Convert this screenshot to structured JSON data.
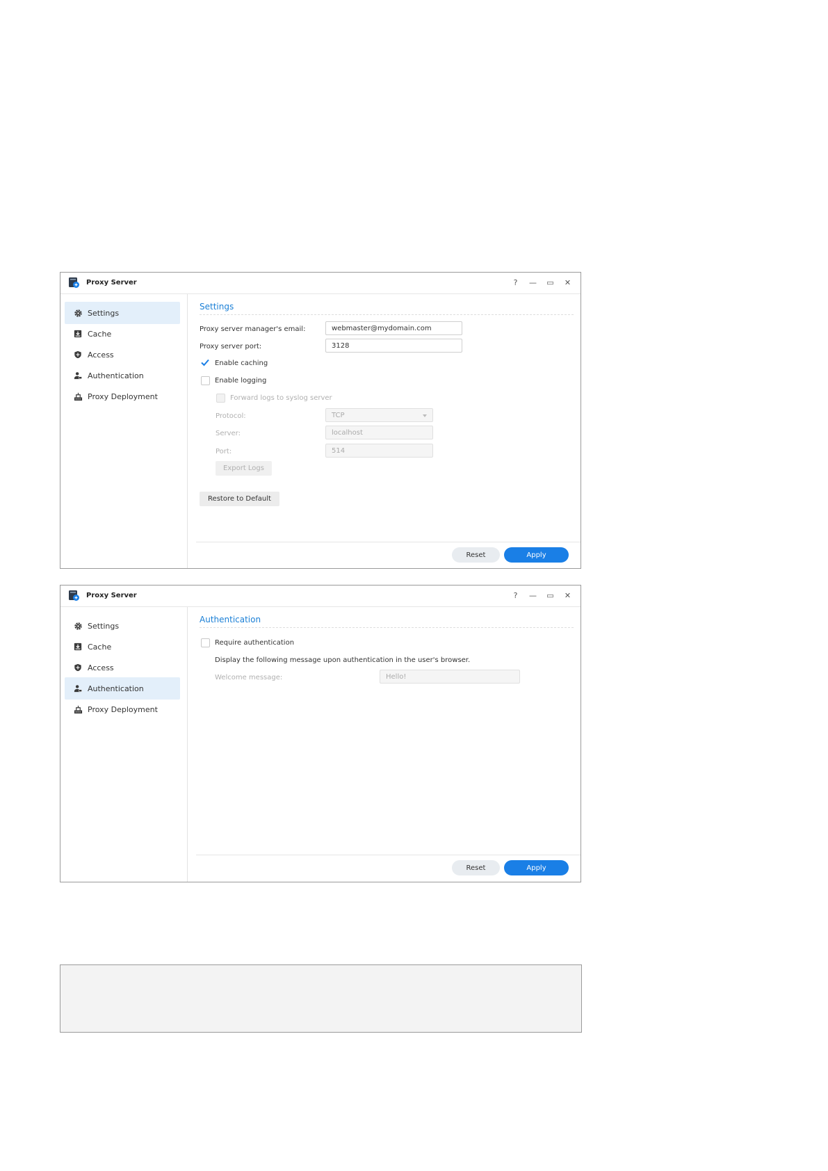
{
  "window1": {
    "title": "Proxy Server",
    "controls": {
      "help": "?",
      "minimize": "—",
      "maximize": "▭",
      "close": "✕"
    },
    "sidebar": [
      {
        "label": "Settings",
        "icon": "gear-icon",
        "active": true
      },
      {
        "label": "Cache",
        "icon": "cache-icon"
      },
      {
        "label": "Access",
        "icon": "shield-icon"
      },
      {
        "label": "Authentication",
        "icon": "user-icon"
      },
      {
        "label": "Proxy Deployment",
        "icon": "network-icon"
      }
    ],
    "section_title": "Settings",
    "email_label": "Proxy server manager's email:",
    "email_value": "webmaster@mydomain.com",
    "port_label": "Proxy server port:",
    "port_value": "3128",
    "enable_caching_label": "Enable caching",
    "enable_caching_checked": true,
    "enable_logging_label": "Enable logging",
    "enable_logging_checked": false,
    "forward_logs_label": "Forward logs to syslog server",
    "protocol_label": "Protocol:",
    "protocol_value": "TCP",
    "server_label": "Server:",
    "server_value": "localhost",
    "syslog_port_label": "Port:",
    "syslog_port_value": "514",
    "export_logs_label": "Export Logs",
    "restore_label": "Restore to Default",
    "reset_label": "Reset",
    "apply_label": "Apply"
  },
  "window2": {
    "title": "Proxy Server",
    "controls": {
      "help": "?",
      "minimize": "—",
      "maximize": "▭",
      "close": "✕"
    },
    "sidebar": [
      {
        "label": "Settings",
        "icon": "gear-icon"
      },
      {
        "label": "Cache",
        "icon": "cache-icon"
      },
      {
        "label": "Access",
        "icon": "shield-icon"
      },
      {
        "label": "Authentication",
        "icon": "user-icon",
        "active": true
      },
      {
        "label": "Proxy Deployment",
        "icon": "network-icon"
      }
    ],
    "section_title": "Authentication",
    "require_auth_label": "Require authentication",
    "require_auth_checked": false,
    "message_text": "Display the following message upon authentication in the user's browser.",
    "welcome_label": "Welcome message:",
    "welcome_value": "Hello!",
    "reset_label": "Reset",
    "apply_label": "Apply"
  },
  "colors": {
    "accent": "#1a7fd6",
    "apply_button": "#1a7fe6",
    "active_nav": "#e3effa"
  }
}
